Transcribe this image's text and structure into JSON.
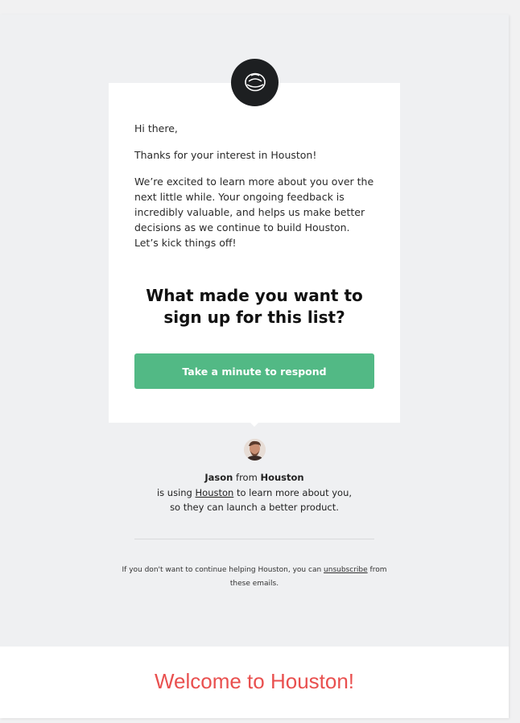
{
  "email": {
    "greeting": "Hi there,",
    "thanks": "Thanks for your interest in Houston!",
    "intro": "We’re excited to learn more about you over the next little while. Your ongoing feedback is incredibly valuable, and helps us make better decisions as we continue to build Houston. Let’s kick things off!",
    "question": "What made you want to sign up for this list?",
    "cta_label": "Take a minute to respond"
  },
  "sender": {
    "name": "Jason",
    "from_word": "from",
    "company": "Houston",
    "using_prefix": "is using",
    "using_link": "Houston",
    "using_suffix": "to learn more about you,",
    "line3": "so they can launch a better product."
  },
  "footer": {
    "prefix": "If you don't want to continue helping Houston, you can",
    "unsubscribe": "unsubscribe",
    "suffix": "from these emails."
  },
  "banner": {
    "title": "Welcome to Houston!"
  },
  "colors": {
    "accent_button": "#52b985",
    "banner_title": "#e9504f",
    "logo_bg": "#1d1f21"
  }
}
